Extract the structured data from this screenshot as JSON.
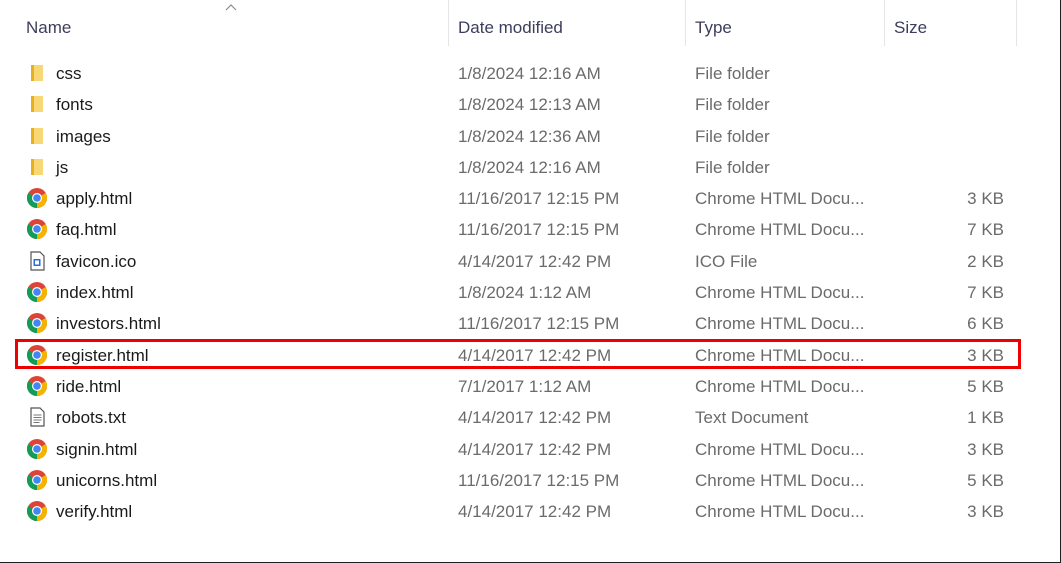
{
  "columns": {
    "name": "Name",
    "date": "Date modified",
    "type": "Type",
    "size": "Size"
  },
  "sort": {
    "column": "name",
    "direction": "ascending",
    "icon": "caret-up-icon"
  },
  "colors": {
    "highlight": "#ee0000",
    "folder": "#f5c542",
    "header_text": "#3d3d5c",
    "secondary_text": "#6b6b6b"
  },
  "files": [
    {
      "name": "css",
      "date": "1/8/2024 12:16 AM",
      "type": "File folder",
      "size": "",
      "icon": "folder-icon"
    },
    {
      "name": "fonts",
      "date": "1/8/2024 12:13 AM",
      "type": "File folder",
      "size": "",
      "icon": "folder-icon"
    },
    {
      "name": "images",
      "date": "1/8/2024 12:36 AM",
      "type": "File folder",
      "size": "",
      "icon": "folder-icon"
    },
    {
      "name": "js",
      "date": "1/8/2024 12:16 AM",
      "type": "File folder",
      "size": "",
      "icon": "folder-icon"
    },
    {
      "name": "apply.html",
      "date": "11/16/2017 12:15 PM",
      "type": "Chrome HTML Docu...",
      "size": "3 KB",
      "icon": "chrome-icon"
    },
    {
      "name": "faq.html",
      "date": "11/16/2017 12:15 PM",
      "type": "Chrome HTML Docu...",
      "size": "7 KB",
      "icon": "chrome-icon"
    },
    {
      "name": "favicon.ico",
      "date": "4/14/2017 12:42 PM",
      "type": "ICO File",
      "size": "2 KB",
      "icon": "image-file-icon"
    },
    {
      "name": "index.html",
      "date": "1/8/2024 1:12 AM",
      "type": "Chrome HTML Docu...",
      "size": "7 KB",
      "icon": "chrome-icon"
    },
    {
      "name": "investors.html",
      "date": "11/16/2017 12:15 PM",
      "type": "Chrome HTML Docu...",
      "size": "6 KB",
      "icon": "chrome-icon"
    },
    {
      "name": "register.html",
      "date": "4/14/2017 12:42 PM",
      "type": "Chrome HTML Docu...",
      "size": "3 KB",
      "icon": "chrome-icon",
      "highlighted": true
    },
    {
      "name": "ride.html",
      "date": "7/1/2017 1:12 AM",
      "type": "Chrome HTML Docu...",
      "size": "5 KB",
      "icon": "chrome-icon"
    },
    {
      "name": "robots.txt",
      "date": "4/14/2017 12:42 PM",
      "type": "Text Document",
      "size": "1 KB",
      "icon": "text-file-icon"
    },
    {
      "name": "signin.html",
      "date": "4/14/2017 12:42 PM",
      "type": "Chrome HTML Docu...",
      "size": "3 KB",
      "icon": "chrome-icon"
    },
    {
      "name": "unicorns.html",
      "date": "11/16/2017 12:15 PM",
      "type": "Chrome HTML Docu...",
      "size": "5 KB",
      "icon": "chrome-icon"
    },
    {
      "name": "verify.html",
      "date": "4/14/2017 12:42 PM",
      "type": "Chrome HTML Docu...",
      "size": "3 KB",
      "icon": "chrome-icon"
    }
  ]
}
